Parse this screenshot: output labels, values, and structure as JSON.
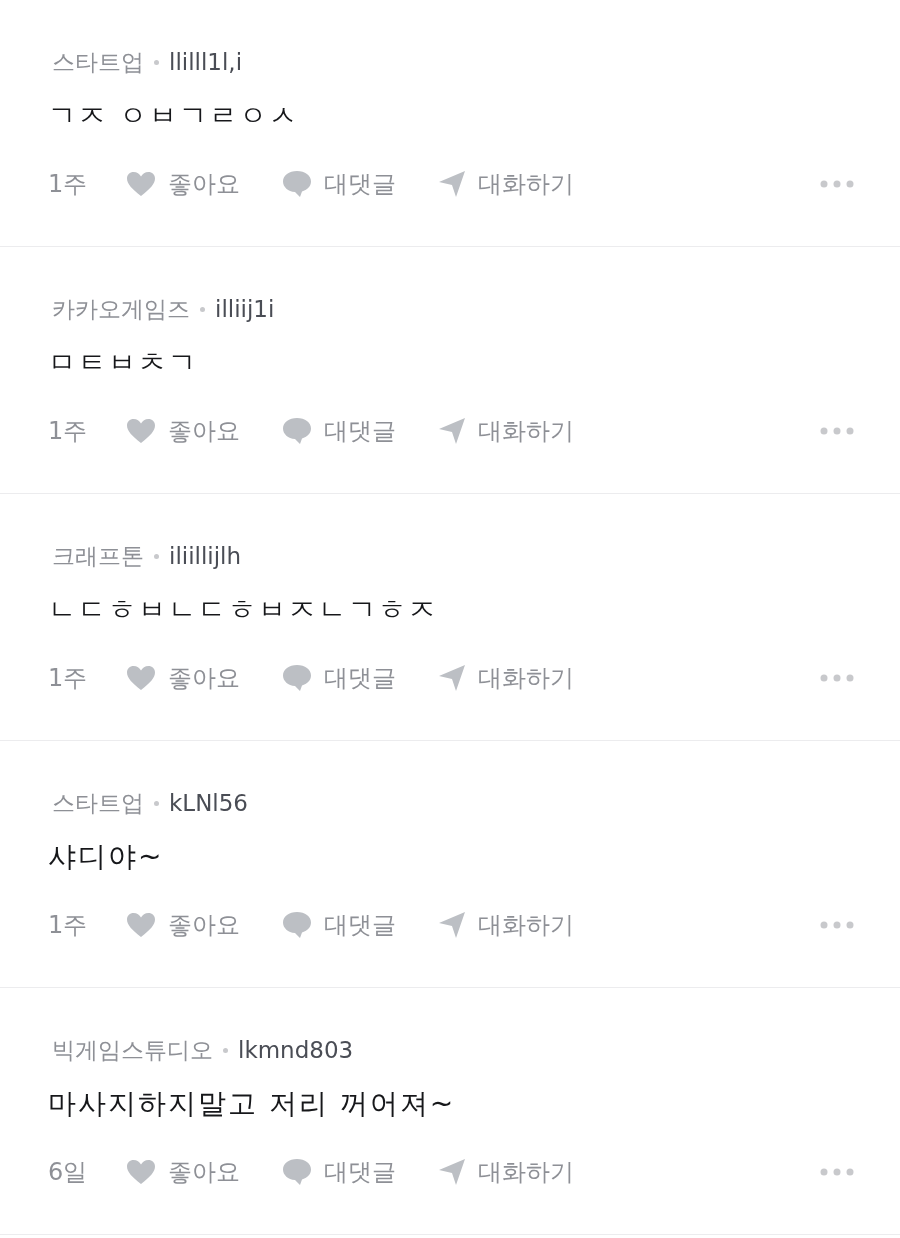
{
  "comments": [
    {
      "company": "스타트업",
      "nickname": "llilll1l,i",
      "text": "ㄱㅈ ㅇㅂㄱㄹㅇㅅ",
      "time": "1주",
      "like": "좋아요",
      "reply": "대댓글",
      "chat": "대화하기"
    },
    {
      "company": "카카오게임즈",
      "nickname": "illiij1i",
      "text": "ㅁㅌㅂㅊㄱ",
      "time": "1주",
      "like": "좋아요",
      "reply": "대댓글",
      "chat": "대화하기"
    },
    {
      "company": "크래프톤",
      "nickname": "iliillijlh",
      "text": "ㄴㄷㅎㅂㄴㄷㅎㅂㅈㄴㄱㅎㅈ",
      "time": "1주",
      "like": "좋아요",
      "reply": "대댓글",
      "chat": "대화하기"
    },
    {
      "company": "스타트업",
      "nickname": "kLNl56",
      "text": "샤디야~",
      "time": "1주",
      "like": "좋아요",
      "reply": "대댓글",
      "chat": "대화하기"
    },
    {
      "company": "빅게임스튜디오",
      "nickname": "lkmnd803",
      "text": "마사지하지말고 저리 꺼어져~",
      "time": "6일",
      "like": "좋아요",
      "reply": "대댓글",
      "chat": "대화하기"
    }
  ]
}
